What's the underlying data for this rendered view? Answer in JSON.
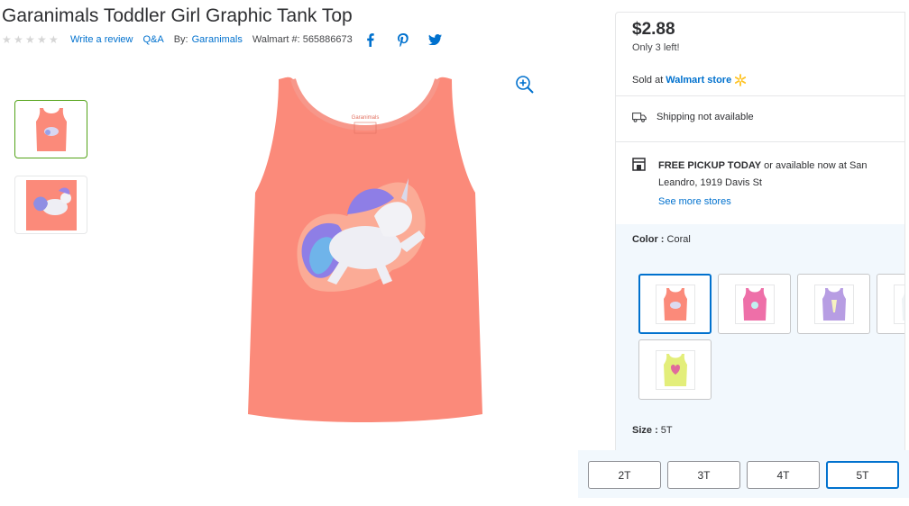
{
  "product": {
    "title": "Garanimals Toddler Girl Graphic Tank Top",
    "rating_stars": 5,
    "write_review": "Write a review",
    "qa": "Q&A",
    "by_prefix": "By:",
    "brand": "Garanimals",
    "walmart_number": "Walmart #: 565886673"
  },
  "social": {
    "facebook_icon": "f",
    "pinterest_icon": "p",
    "twitter_icon": "twitter-bird"
  },
  "thumbnails": [
    {
      "name": "tank-front",
      "selected": true
    },
    {
      "name": "unicorn-closeup",
      "selected": false
    }
  ],
  "panel": {
    "price": "$2.88",
    "stock": "Only 3 left!",
    "sold_prefix": "Sold at",
    "sold_store": "Walmart store",
    "shipping": "Shipping not available",
    "pickup_bold": "FREE PICKUP TODAY",
    "pickup_rest": " or available now at San Leandro, 1919 Davis St",
    "see_more": "See more stores"
  },
  "color": {
    "label": "Color :",
    "value": "Coral",
    "swatches": [
      {
        "name": "coral",
        "color": "#fb8a7a",
        "selected": true
      },
      {
        "name": "pink",
        "color": "#ee6fa8",
        "selected": false
      },
      {
        "name": "purple",
        "color": "#b79de3",
        "selected": false
      },
      {
        "name": "white",
        "color": "#eef3f5",
        "selected": false
      },
      {
        "name": "yellow",
        "color": "#e3ee7a",
        "selected": false
      }
    ]
  },
  "size": {
    "label": "Size :",
    "value": "5T",
    "options": [
      {
        "label": "2T",
        "selected": false
      },
      {
        "label": "3T",
        "selected": false
      },
      {
        "label": "4T",
        "selected": false
      },
      {
        "label": "5T",
        "selected": true
      }
    ]
  },
  "colors": {
    "accent": "#0071ce",
    "spark": "#ffc220",
    "selected_thumb": "#53a318",
    "tank_coral": "#fb8a7a"
  }
}
